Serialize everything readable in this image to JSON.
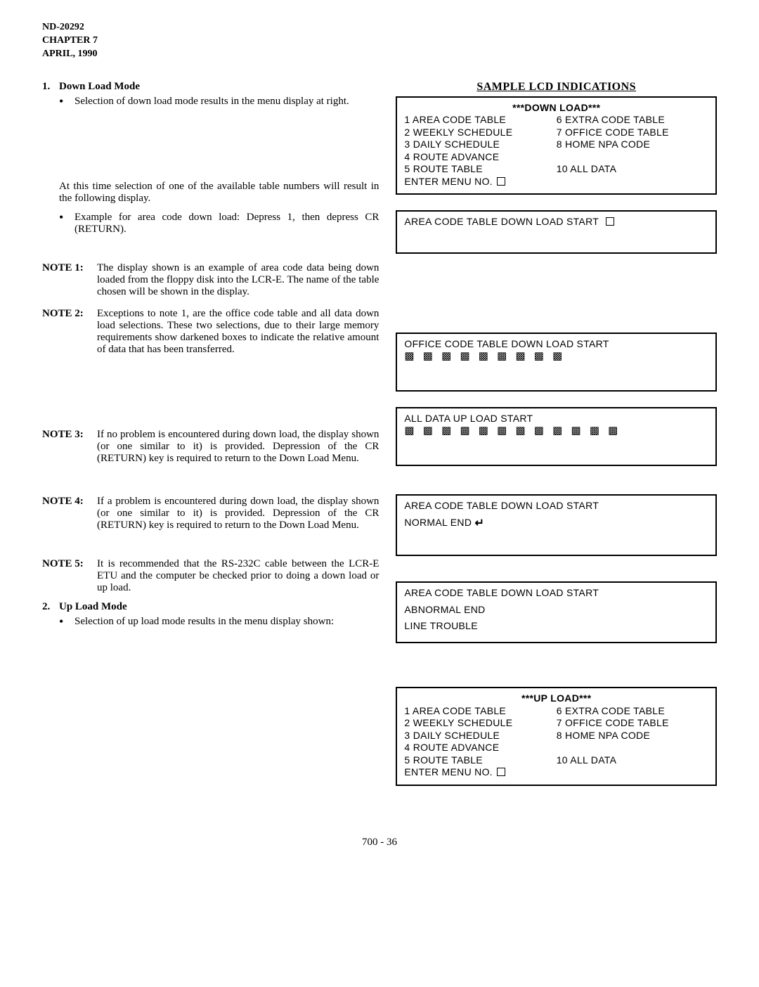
{
  "header": {
    "doc_no": "ND-20292",
    "chapter": "CHAPTER 7",
    "date": "APRIL, 1990"
  },
  "left": {
    "item1_num": "1.",
    "item1_title": "Down Load Mode",
    "item1_bullet": "Selection of down load mode results in the menu display at right.",
    "para_after": "At this time selection of one of the available table numbers will result in the following display.",
    "example_bullet": "Example for area code down load: Depress 1, then depress CR (RETURN).",
    "note1_label": "NOTE 1:",
    "note1_text": "The display shown is an example of area code data being down loaded from the floppy disk into the LCR-E. The name of the table chosen will be shown in the display.",
    "note2_label": "NOTE 2:",
    "note2_text": "Exceptions to note 1, are the office code table and all data down load selections. These two selections, due to their large memory requirements show darkened boxes to indicate the relative amount of data that has been transferred.",
    "note3_label": "NOTE 3:",
    "note3_text": "If no problem is encountered during down load, the display shown (or one similar to it) is provided. Depression of the CR (RETURN) key is required to return to the Down Load Menu.",
    "note4_label": "NOTE 4:",
    "note4_text": "If a problem is encountered during down load, the display shown (or one similar to it) is provided. Depression of the CR (RETURN) key is required to return to the Down Load Menu.",
    "note5_label": "NOTE 5:",
    "note5_text": "It is recommended that the RS-232C cable between the LCR-E ETU and the computer be checked prior to doing a down load or up load.",
    "item2_num": "2.",
    "item2_title": "Up Load Mode",
    "item2_bullet": "Selection of up load mode results in the menu display shown:"
  },
  "right": {
    "heading": "SAMPLE LCD INDICATIONS",
    "lcd1": {
      "title": "***DOWN LOAD***",
      "colA": "1 AREA CODE TABLE\n2 WEEKLY SCHEDULE\n3 DAILY SCHEDULE\n4 ROUTE ADVANCE\n5 ROUTE TABLE",
      "colB": "6 EXTRA CODE TABLE\n7 OFFICE CODE TABLE\n8 HOME NPA CODE\n\n10 ALL DATA",
      "enter": "ENTER MENU NO."
    },
    "lcd2": {
      "line1": "AREA CODE TABLE DOWN LOAD START"
    },
    "lcd3": {
      "line1": "OFFICE CODE TABLE DOWN LOAD START",
      "blocks": "▩ ▩ ▩ ▩ ▩ ▩ ▩ ▩ ▩"
    },
    "lcd4": {
      "line1": "ALL DATA UP LOAD START",
      "blocks": "▩ ▩ ▩ ▩ ▩ ▩ ▩ ▩ ▩ ▩ ▩ ▩"
    },
    "lcd5": {
      "line1": "AREA CODE TABLE DOWN LOAD START",
      "line2": "NORMAL END"
    },
    "lcd6": {
      "line1": "AREA CODE TABLE DOWN LOAD START",
      "line2": "ABNORMAL END",
      "line3": "LINE TROUBLE"
    },
    "lcd7": {
      "title": "***UP LOAD***",
      "colA": "1 AREA CODE TABLE\n2 WEEKLY SCHEDULE\n3 DAILY SCHEDULE\n4 ROUTE ADVANCE\n5 ROUTE TABLE",
      "colB": "6 EXTRA CODE TABLE\n7 OFFICE CODE TABLE\n8 HOME NPA CODE\n\n10 ALL DATA",
      "enter": "ENTER MENU NO."
    }
  },
  "footer": "700 - 36"
}
